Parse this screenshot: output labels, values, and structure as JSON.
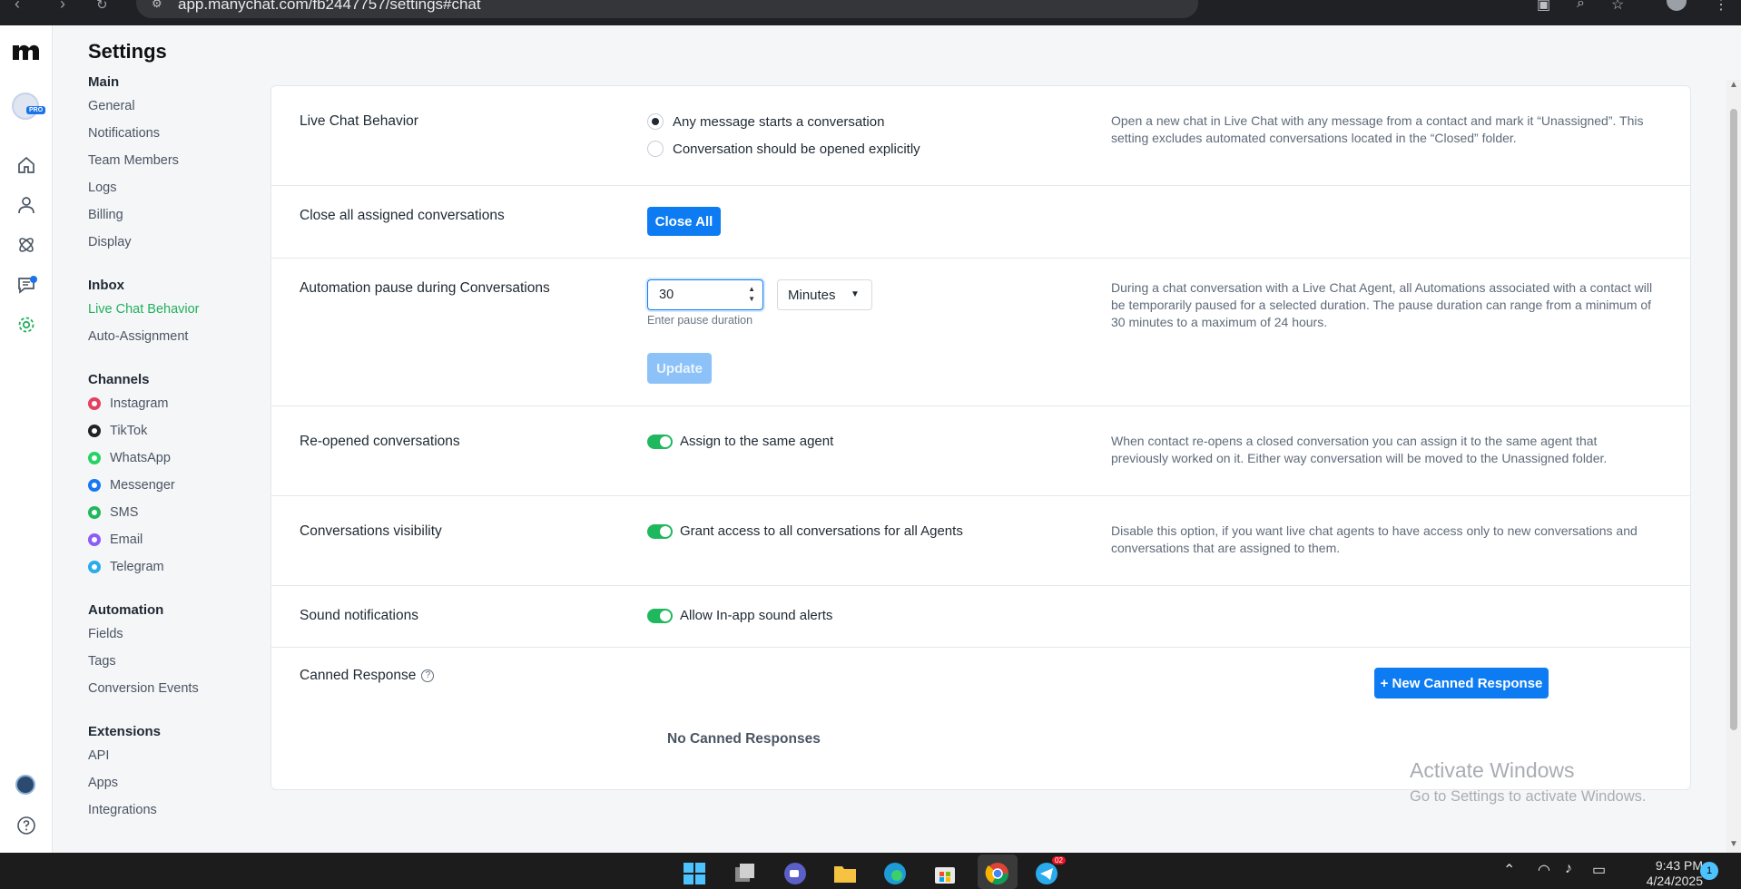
{
  "browser": {
    "url": "app.manychat.com/fb2447757/settings#chat"
  },
  "header": {
    "title": "Settings"
  },
  "sidebar": {
    "sections": [
      {
        "title": "Main",
        "items": [
          "General",
          "Notifications",
          "Team Members",
          "Logs",
          "Billing",
          "Display"
        ]
      },
      {
        "title": "Inbox",
        "items": [
          "Live Chat Behavior",
          "Auto-Assignment"
        ],
        "active": "Live Chat Behavior"
      },
      {
        "title": "Channels",
        "items": [
          "Instagram",
          "TikTok",
          "WhatsApp",
          "Messenger",
          "SMS",
          "Email",
          "Telegram"
        ]
      },
      {
        "title": "Automation",
        "items": [
          "Fields",
          "Tags",
          "Conversion Events"
        ]
      },
      {
        "title": "Extensions",
        "items": [
          "API",
          "Apps",
          "Integrations"
        ]
      }
    ],
    "channel_colors": [
      "#e4405f",
      "#222222",
      "#25d366",
      "#1877f2",
      "#20b85e",
      "#8b5cf6",
      "#2aabee"
    ]
  },
  "settings": {
    "live_chat": {
      "title": "Live Chat Behavior",
      "option_1": "Any message starts a conversation",
      "option_2": "Conversation should be opened explicitly",
      "selected": "option_1",
      "desc": "Open a new chat in Live Chat with any message from a contact and mark it “Unassigned”. This setting excludes automated conversations located in the “Closed” folder."
    },
    "close_all": {
      "title": "Close all assigned conversations",
      "button": "Close All"
    },
    "pause": {
      "title": "Automation pause during Conversations",
      "value": "30",
      "unit": "Minutes",
      "hint": "Enter pause duration",
      "button": "Update",
      "desc": "During a chat conversation with a Live Chat Agent, all Automations associated with a contact will be temporarily paused for a selected duration. The pause duration can range from a minimum of 30 minutes to a maximum of 24 hours."
    },
    "reopened": {
      "title": "Re-opened conversations",
      "toggle_label": "Assign to the same agent",
      "enabled": true,
      "desc": "When contact re-opens a closed conversation you can assign it to the same agent that previously worked on it. Either way conversation will be moved to the Unassigned folder."
    },
    "visibility": {
      "title": "Conversations visibility",
      "toggle_label": "Grant access to all conversations for all Agents",
      "enabled": true,
      "desc": "Disable this option, if you want live chat agents to have access only to new conversations and conversations that are assigned to them."
    },
    "sound": {
      "title": "Sound notifications",
      "toggle_label": "Allow In-app sound alerts",
      "enabled": true
    },
    "canned": {
      "title": "Canned Response",
      "button": "+ New Canned Response",
      "empty": "No Canned Responses"
    }
  },
  "watermark": {
    "line1": "Activate Windows",
    "line2": "Go to Settings to activate Windows."
  },
  "taskbar": {
    "time": "9:43 PM",
    "date": "4/24/2025",
    "telegram_badge": "02",
    "notifications": "1"
  },
  "colors": {
    "accent": "#0d7cf2",
    "active_nav": "#22b05d",
    "toggle_on": "#20b85e"
  }
}
